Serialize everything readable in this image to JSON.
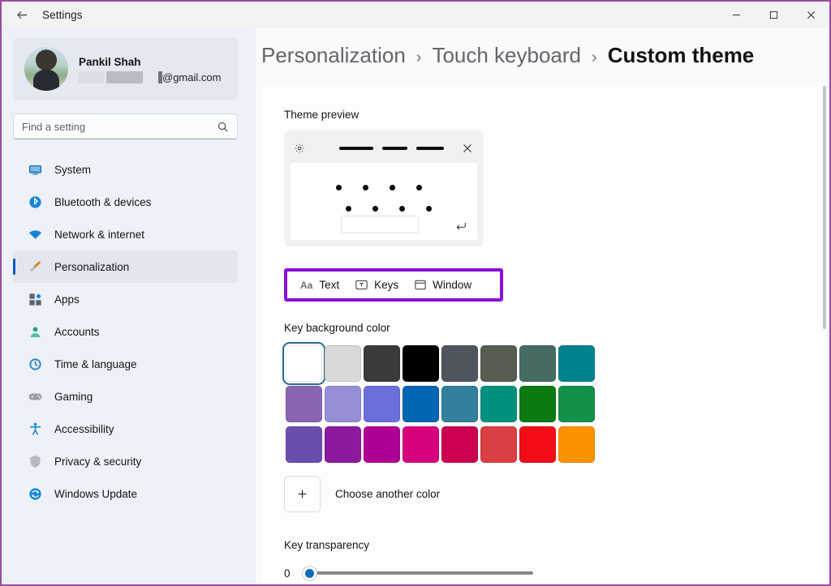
{
  "window": {
    "title": "Settings",
    "back_icon": "back-arrow-icon",
    "minimize_label": "–",
    "maximize_label": "□",
    "close_label": "✕"
  },
  "sidebar": {
    "account": {
      "name": "Pankil Shah",
      "email_suffix": "@gmail.com"
    },
    "search": {
      "placeholder": "Find a setting",
      "value": "",
      "icon": "search-icon"
    },
    "items": [
      {
        "label": "System",
        "icon": "monitor-icon",
        "active": false
      },
      {
        "label": "Bluetooth & devices",
        "icon": "bluetooth-icon",
        "active": false
      },
      {
        "label": "Network & internet",
        "icon": "wifi-icon",
        "active": false
      },
      {
        "label": "Personalization",
        "icon": "paintbrush-icon",
        "active": true
      },
      {
        "label": "Apps",
        "icon": "apps-icon",
        "active": false
      },
      {
        "label": "Accounts",
        "icon": "person-icon",
        "active": false
      },
      {
        "label": "Time & language",
        "icon": "clock-icon",
        "active": false
      },
      {
        "label": "Gaming",
        "icon": "gamepad-icon",
        "active": false
      },
      {
        "label": "Accessibility",
        "icon": "accessibility-icon",
        "active": false
      },
      {
        "label": "Privacy & security",
        "icon": "shield-icon",
        "active": false
      },
      {
        "label": "Windows Update",
        "icon": "update-icon",
        "active": false
      }
    ]
  },
  "breadcrumb": {
    "root": "Personalization",
    "sep": "›",
    "parent": "Touch keyboard",
    "current": "Custom theme"
  },
  "main": {
    "preview_label": "Theme preview",
    "preview": {
      "gear_icon": "gear-icon",
      "close_icon": "close-icon",
      "enter_icon": "enter-key-icon"
    },
    "tabs": [
      {
        "label": "Text",
        "icon": "text-aa-icon",
        "icon_text": "Aa",
        "selected": true
      },
      {
        "label": "Keys",
        "icon": "key-box-icon",
        "icon_text": "T",
        "selected": false
      },
      {
        "label": "Window",
        "icon": "window-icon",
        "icon_text": "",
        "selected": false
      }
    ],
    "key_background_label": "Key background color",
    "swatches": [
      {
        "hex": "#ffffff",
        "selected": true
      },
      {
        "hex": "#d9d9d9",
        "selected": false
      },
      {
        "hex": "#3a3a38",
        "selected": false
      },
      {
        "hex": "#000000",
        "selected": false
      },
      {
        "hex": "#4f555c",
        "selected": false
      },
      {
        "hex": "#575e51",
        "selected": false
      },
      {
        "hex": "#456b63",
        "selected": false
      },
      {
        "hex": "#00838f",
        "selected": false
      },
      {
        "hex": "#8a65b2",
        "selected": false
      },
      {
        "hex": "#9590d6",
        "selected": false
      },
      {
        "hex": "#6b6fdb",
        "selected": false
      },
      {
        "hex": "#0066b4",
        "selected": false
      },
      {
        "hex": "#33809e",
        "selected": false
      },
      {
        "hex": "#00917e",
        "selected": false
      },
      {
        "hex": "#0b7a12",
        "selected": false
      },
      {
        "hex": "#13914a",
        "selected": false
      },
      {
        "hex": "#6a4eae",
        "selected": false
      },
      {
        "hex": "#8c1a9e",
        "selected": false
      },
      {
        "hex": "#ae0093",
        "selected": false
      },
      {
        "hex": "#d6007c",
        "selected": false
      },
      {
        "hex": "#cb0050",
        "selected": false
      },
      {
        "hex": "#d93f43",
        "selected": false
      },
      {
        "hex": "#f10c16",
        "selected": false
      },
      {
        "hex": "#fa9200",
        "selected": false
      }
    ],
    "choose_another_color": "Choose another color",
    "choose_icon": "plus-icon",
    "key_transparency_label": "Key transparency",
    "transparency_value": "0",
    "transparency_min": 0,
    "transparency_max": 100
  },
  "colors": {
    "accent": "#0f6cbd",
    "annotation": "#8a10d6",
    "frame": "#9a4b9e",
    "sidebar_bg": "#eef1f8",
    "panel_bg": "#fdfdfe"
  }
}
